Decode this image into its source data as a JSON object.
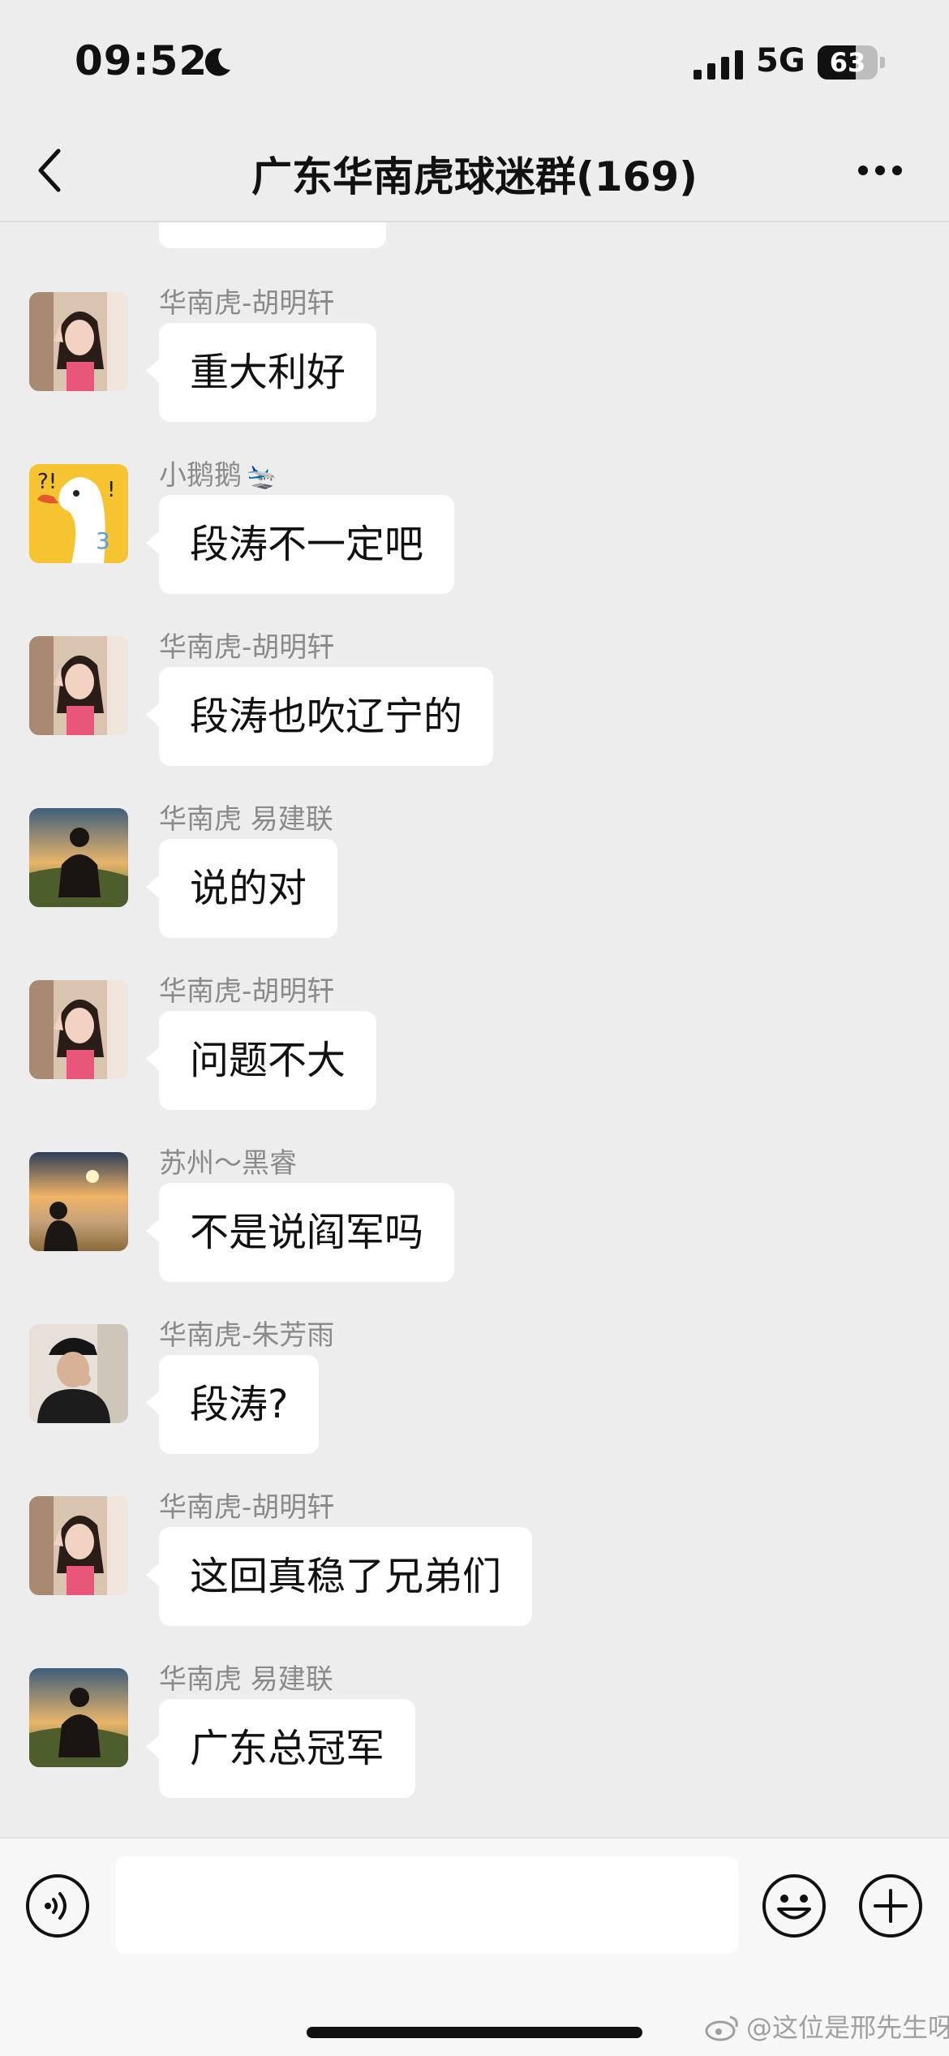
{
  "status_bar": {
    "time": "09:52",
    "network": "5G",
    "battery_level": "63",
    "battery_fraction": 0.63
  },
  "nav": {
    "title": "广东华南虎球迷群(169)"
  },
  "messages": [
    {
      "sender": "华南虎-胡明轩",
      "text": "重大利好",
      "avatar": "girl-avatar"
    },
    {
      "sender": "小鹅鹅",
      "sender_emoji": "🛬",
      "text": "段涛不一定吧",
      "avatar": "goose-avatar"
    },
    {
      "sender": "华南虎-胡明轩",
      "text": "段涛也吹辽宁的",
      "avatar": "girl-avatar"
    },
    {
      "sender": "华南虎  易建联",
      "text": "说的对",
      "avatar": "sunset-man-avatar"
    },
    {
      "sender": "华南虎-胡明轩",
      "text": "问题不大",
      "avatar": "girl-avatar"
    },
    {
      "sender": "苏州～黑睿",
      "text": "不是说阎军吗",
      "avatar": "sea-of-clouds-avatar"
    },
    {
      "sender": "华南虎-朱芳雨",
      "text": "段涛?",
      "avatar": "cap-man-avatar"
    },
    {
      "sender": "华南虎-胡明轩",
      "text": "这回真稳了兄弟们",
      "avatar": "girl-avatar"
    },
    {
      "sender": "华南虎  易建联",
      "text": "广东总冠军",
      "avatar": "sunset-man-avatar"
    }
  ],
  "input": {
    "placeholder": ""
  },
  "watermark": "@这位是邢先生呀"
}
